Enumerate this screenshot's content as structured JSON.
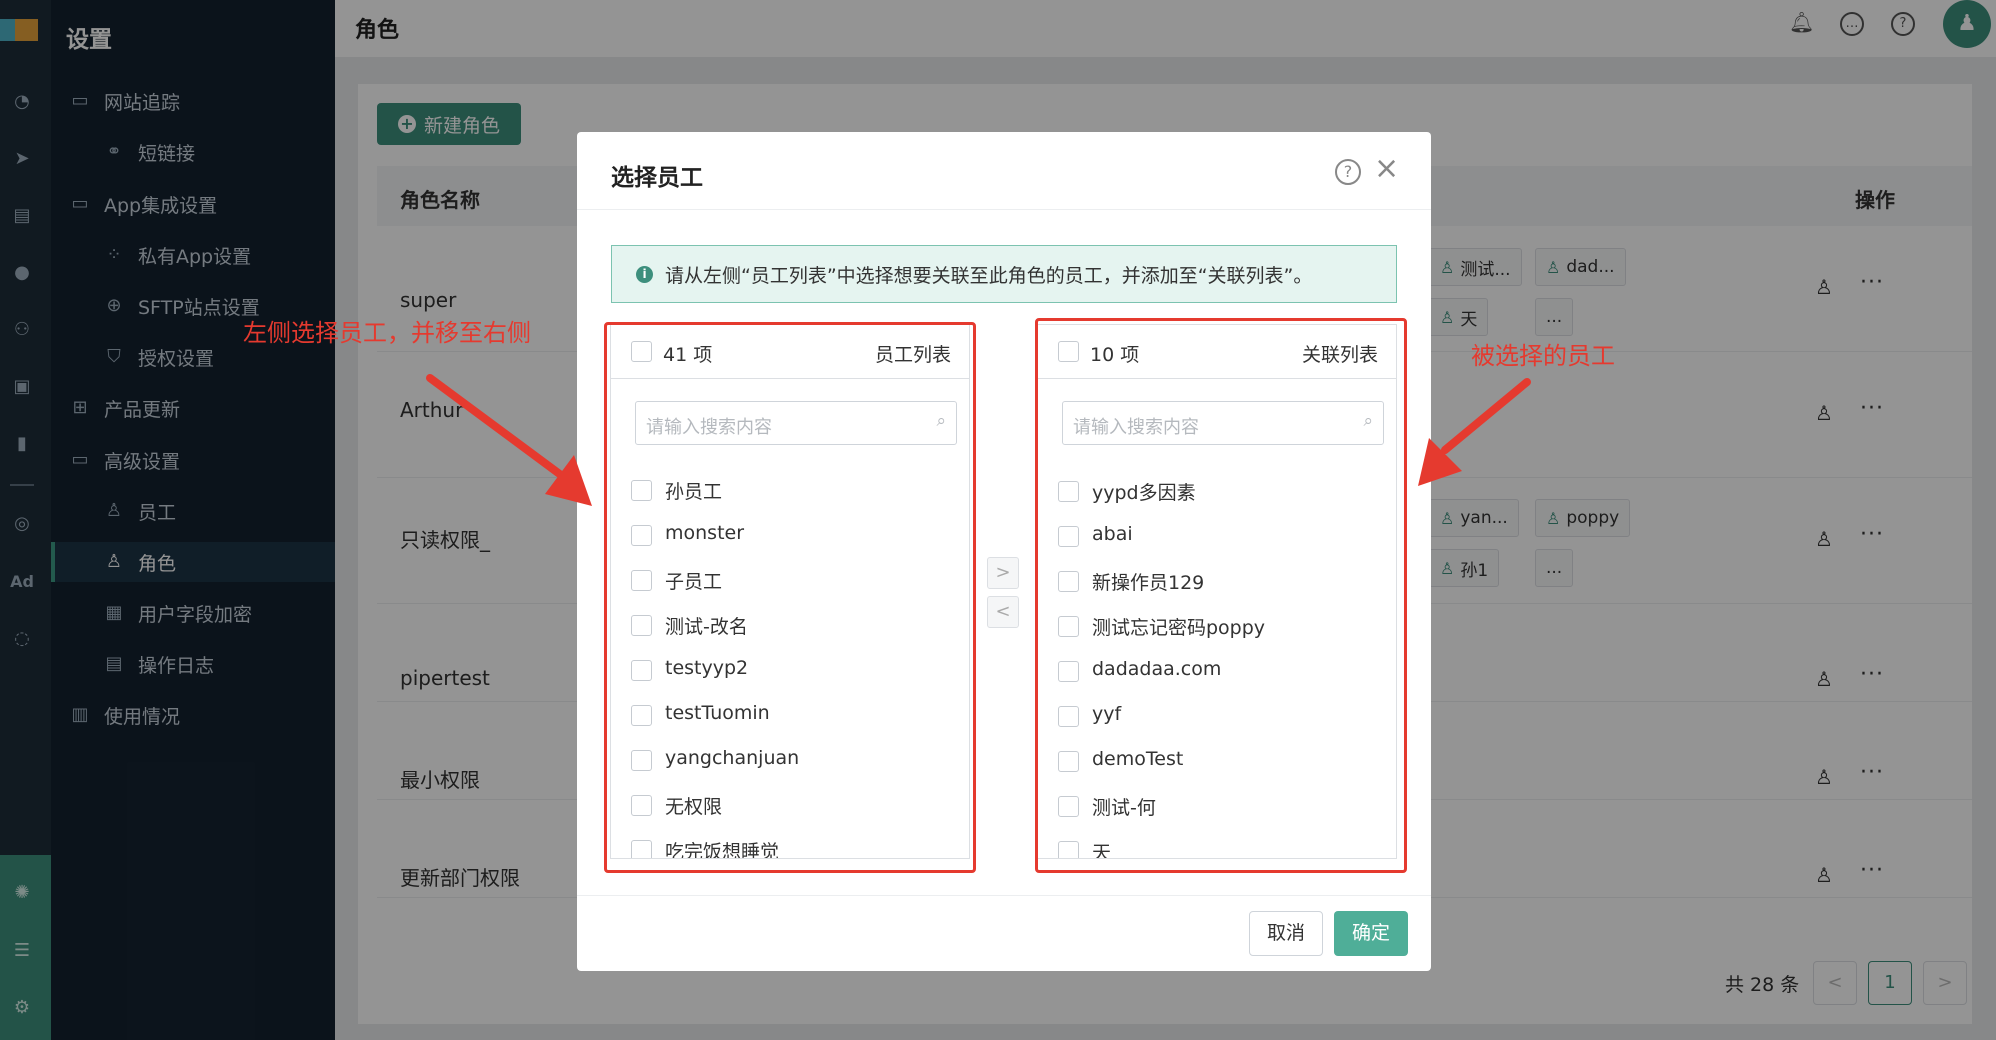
{
  "sidebar": {
    "title": "设置",
    "items": [
      {
        "label": "网站追踪",
        "icon": "folder-icon"
      },
      {
        "label": "短链接",
        "icon": "link-icon"
      },
      {
        "label": "App集成设置",
        "icon": "folder-icon"
      },
      {
        "label": "私有App设置",
        "icon": "apps-icon"
      },
      {
        "label": "SFTP站点设置",
        "icon": "globe-icon"
      },
      {
        "label": "授权设置",
        "icon": "shield-icon"
      },
      {
        "label": "产品更新",
        "icon": "grid-icon"
      },
      {
        "label": "高级设置",
        "icon": "folder-icon"
      },
      {
        "label": "员工",
        "icon": "user-icon"
      },
      {
        "label": "角色",
        "icon": "user-role-icon",
        "active": true
      },
      {
        "label": "用户字段加密",
        "icon": "encrypt-icon"
      },
      {
        "label": "操作日志",
        "icon": "log-icon"
      },
      {
        "label": "使用情况",
        "icon": "usage-icon"
      }
    ],
    "rail_ad_label": "Ad"
  },
  "header": {
    "title": "角色",
    "avatar_icon": "avatar-icon"
  },
  "page": {
    "new_button": "新建角色",
    "col_name": "角色名称",
    "col_action": "操作",
    "more_label": "···",
    "rows": [
      {
        "name": "super",
        "tags": [
          "测试...",
          "dad...",
          "天",
          "..."
        ]
      },
      {
        "name": "Arthur",
        "tags": []
      },
      {
        "name": "只读权限_",
        "tags": [
          "yan...",
          "poppy",
          "孙1",
          "..."
        ]
      },
      {
        "name": "pipertest",
        "tags": []
      },
      {
        "name": "最小权限",
        "tags": []
      },
      {
        "name": "更新部门权限",
        "tags": []
      }
    ],
    "total": "共 28 条",
    "current_page": "1",
    "prev": "<",
    "next": ">"
  },
  "modal": {
    "title": "选择员工",
    "notice": "请从左侧“员工列表”中选择想要关联至此角色的员工，并添加至“关联列表”。",
    "left": {
      "count": "41 项",
      "title": "员工列表",
      "placeholder": "请输入搜索内容",
      "items": [
        "孙员工",
        "monster",
        "子员工",
        "测试-改名",
        "testyyp2",
        "testTuomin",
        "yangchanjuan",
        "无权限",
        "吃完饭想睡觉"
      ]
    },
    "right": {
      "count": "10 项",
      "title": "关联列表",
      "placeholder": "请输入搜索内容",
      "items": [
        "yypd多因素",
        "abai",
        "新操作员129",
        "测试忘记密码poppy",
        "dadadaa.com",
        "yyf",
        "demoTest",
        "测试-何",
        "天"
      ]
    },
    "move_right": ">",
    "move_left": "<",
    "cancel": "取消",
    "confirm": "确定"
  },
  "annotations": {
    "left": "左侧选择员工，并移至右侧",
    "right": "被选择的员工",
    "color": "#e53a2f"
  }
}
